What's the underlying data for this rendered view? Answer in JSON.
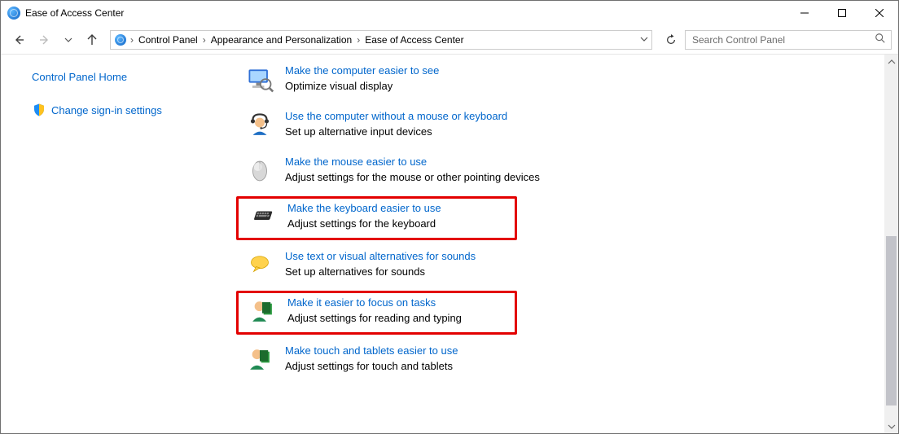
{
  "title": "Ease of Access Center",
  "breadcrumb": [
    "Control Panel",
    "Appearance and Personalization",
    "Ease of Access Center"
  ],
  "search": {
    "placeholder": "Search Control Panel"
  },
  "sidebar": {
    "home": "Control Panel Home",
    "signin": "Change sign-in settings"
  },
  "options": [
    {
      "link": "Make the computer easier to see",
      "desc": "Optimize visual display",
      "icon": "monitor"
    },
    {
      "link": "Use the computer without a mouse or keyboard",
      "desc": "Set up alternative input devices",
      "icon": "headset"
    },
    {
      "link": "Make the mouse easier to use",
      "desc": "Adjust settings for the mouse or other pointing devices",
      "icon": "mouse"
    },
    {
      "link": "Make the keyboard easier to use",
      "desc": "Adjust settings for the keyboard",
      "icon": "keyboard",
      "hl": true
    },
    {
      "link": "Use text or visual alternatives for sounds",
      "desc": "Set up alternatives for sounds",
      "icon": "bubble"
    },
    {
      "link": "Make it easier to focus on tasks",
      "desc": "Adjust settings for reading and typing",
      "icon": "person",
      "hl": true
    },
    {
      "link": "Make touch and tablets easier to use",
      "desc": "Adjust settings for touch and tablets",
      "icon": "person"
    }
  ]
}
